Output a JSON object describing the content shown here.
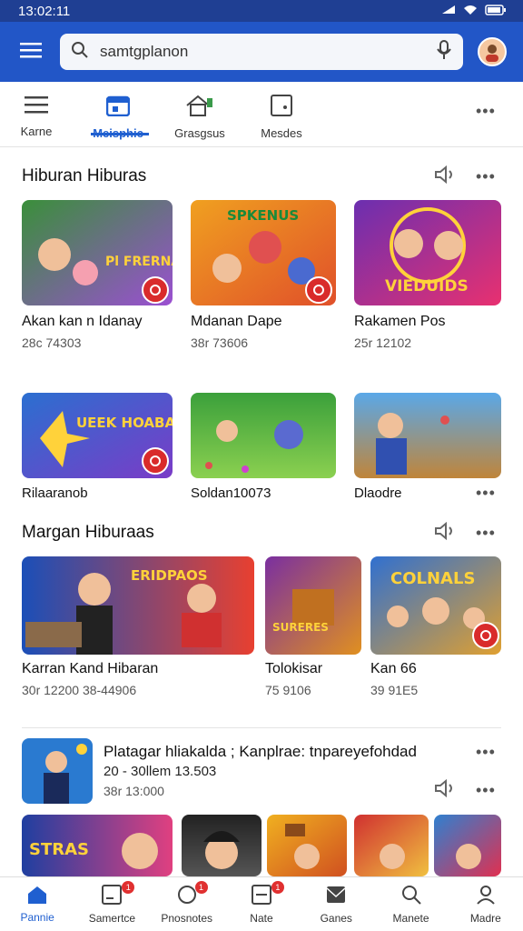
{
  "status": {
    "time": "13:02:11"
  },
  "search": {
    "query": "samtgplanon"
  },
  "tabs": [
    {
      "label": "Karne"
    },
    {
      "label": "Meisphic"
    },
    {
      "label": "Grasgsus"
    },
    {
      "label": "Mesdes"
    }
  ],
  "sections": {
    "s1": {
      "title": "Hiburan Hiburas"
    },
    "s2": {
      "title": "Margan Hiburaas"
    }
  },
  "row1": [
    {
      "name": "Akan kan n Idanay",
      "meta": "28c 74303",
      "art": "Pl FRERNAS",
      "colors": [
        "#3a8f3a",
        "#9b4fd2"
      ]
    },
    {
      "name": "Mdanan Dape",
      "meta": "38r 73606",
      "art": "SPKENUS",
      "colors": [
        "#f0a020",
        "#e0502a"
      ]
    },
    {
      "name": "Rakamen Pos",
      "meta": "25r 12102",
      "art": "VIEDUIDS",
      "colors": [
        "#6b2fb0",
        "#e83070"
      ]
    }
  ],
  "row2": [
    {
      "name": "Rilaaranob",
      "art": "UEEK HOABAS",
      "colors": [
        "#2b6fd0",
        "#7a3cc7"
      ]
    },
    {
      "name": "Soldan10073",
      "art": "",
      "colors": [
        "#3ba03b",
        "#8bd050"
      ]
    },
    {
      "name": "Dlaodre",
      "art": "",
      "colors": [
        "#5aa8e8",
        "#c0853a"
      ]
    }
  ],
  "row3": [
    {
      "name": "Karran Kand Hibaran",
      "meta": "30r 12200   38-44906",
      "art": "ERIDPAOS",
      "colors": [
        "#1b4fb8",
        "#e84030"
      ]
    },
    {
      "name": "Tolokisar",
      "meta": "75 9106",
      "art": "SURERES",
      "colors": [
        "#7a2fa0",
        "#e09020"
      ]
    },
    {
      "name": "Kan 66",
      "meta": "39 91E5",
      "art": "COLNALS",
      "colors": [
        "#3070d0",
        "#e0a030"
      ]
    }
  ],
  "featured": {
    "title": "Platagar hliakalda ; Kanplrae: tnpareyefohdad",
    "line1": "20 - 30llem 13.503",
    "line2": "38r 13:000"
  },
  "row4": [
    {
      "art": "STRAS",
      "colors": [
        "#1f3fa0",
        "#e04080"
      ]
    },
    {
      "art": "",
      "colors": [
        "#222222",
        "#555555"
      ]
    },
    {
      "art": "",
      "colors": [
        "#f0b020",
        "#d05020"
      ]
    },
    {
      "art": "",
      "colors": [
        "#d03030",
        "#f0c040"
      ]
    },
    {
      "art": "",
      "colors": [
        "#2f80d0",
        "#e03050"
      ]
    }
  ],
  "bottom_nav": [
    {
      "label": "Pannie",
      "badge": ""
    },
    {
      "label": "Samertce",
      "badge": "1"
    },
    {
      "label": "Pnosnotes",
      "badge": "1"
    },
    {
      "label": "Nate",
      "badge": "1"
    },
    {
      "label": "Ganes",
      "badge": ""
    },
    {
      "label": "Manete",
      "badge": ""
    },
    {
      "label": "Madre",
      "badge": ""
    }
  ],
  "colors": {
    "appbar": "#2256c7",
    "accent": "#1f5fd0",
    "badge": "#d92b2b"
  }
}
